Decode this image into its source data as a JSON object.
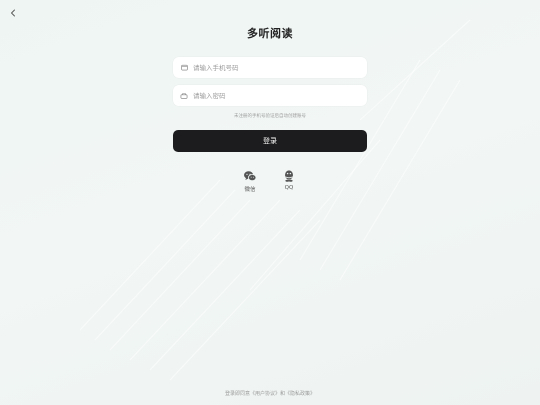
{
  "header": {
    "back_icon": "chevron-left-icon",
    "title": "多听阅读"
  },
  "form": {
    "phone": {
      "icon": "phone-icon",
      "placeholder": "请输入手机号码",
      "value": ""
    },
    "password": {
      "icon": "lock-icon",
      "placeholder": "请输入密码",
      "value": ""
    },
    "hint": "未注册的手机号验证后自动创建账号",
    "login_label": "登录"
  },
  "social": {
    "wechat": {
      "icon": "wechat-icon",
      "label": "微信"
    },
    "qq": {
      "icon": "qq-icon",
      "label": "QQ"
    }
  },
  "footer": {
    "prefix": "登录即同意",
    "user_agreement": "《用户协议》",
    "and": "和",
    "privacy_policy": "《隐私政策》"
  },
  "colors": {
    "button_bg": "#1c1c1e",
    "background": "#eef5f3",
    "field_bg": "#ffffff"
  }
}
